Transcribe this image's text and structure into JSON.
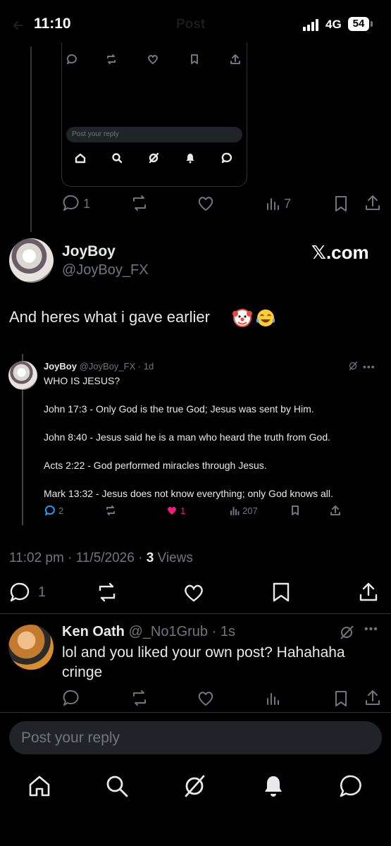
{
  "status_bar": {
    "time": "11:10",
    "network": "4G",
    "battery": "54"
  },
  "header": {
    "title": "Post"
  },
  "inner_screenshot": {
    "reply_placeholder": "Post your reply"
  },
  "top_post_actions": {
    "reply_count": "1",
    "view_count": "7"
  },
  "main_post": {
    "author_name": "JoyBoy",
    "author_handle": "@JoyBoy_FX",
    "brand": "𝕏.com",
    "text": "And heres what i gave earlier",
    "emojis": [
      "clown",
      "tears-of-joy"
    ],
    "timestamp": "11:02 pm · 11/5/2026 · ",
    "views_count": "3",
    "views_label": " Views",
    "reply_count": "1"
  },
  "quoted_post": {
    "author_name": "JoyBoy",
    "author_handle": "@JoyBoy_FX · 1d",
    "title": "WHO IS JESUS?",
    "lines": [
      "John 17:3 - Only God is the true God; Jesus was sent by Him.",
      "John 8:40 - Jesus said he is a man who heard the truth from God.",
      "Acts 2:22 - God performed miracles through Jesus.",
      "Mark 13:32 - Jesus does not know everything; only God knows all."
    ],
    "reply_count": "2",
    "like_count": "1",
    "view_count": "207",
    "like_color": "#f91880"
  },
  "reply_post": {
    "author_name": "Ken Oath",
    "author_handle": "@_No1Grub · 1s",
    "text": "lol and you liked your own post? Hahahaha cringe"
  },
  "reply_box": {
    "placeholder": "Post your reply"
  },
  "bottom_nav": [
    "home-icon",
    "search-icon",
    "grok-icon",
    "notifications-icon",
    "messages-icon"
  ]
}
